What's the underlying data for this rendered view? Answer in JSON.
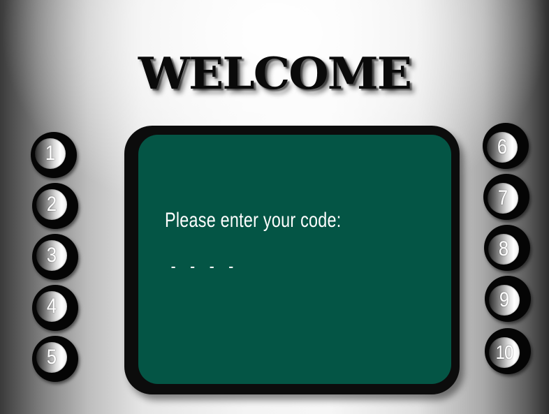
{
  "title": "WELCOME",
  "screen": {
    "prompt": "Please enter your code:",
    "code_display": "- - - -"
  },
  "buttons": {
    "left": [
      "1",
      "2",
      "3",
      "4",
      "5"
    ],
    "right": [
      "6",
      "7",
      "8",
      "9",
      "10"
    ]
  },
  "colors": {
    "screen": "#045545",
    "frame": "#0c0c0c",
    "title": "#0a0a0a"
  }
}
